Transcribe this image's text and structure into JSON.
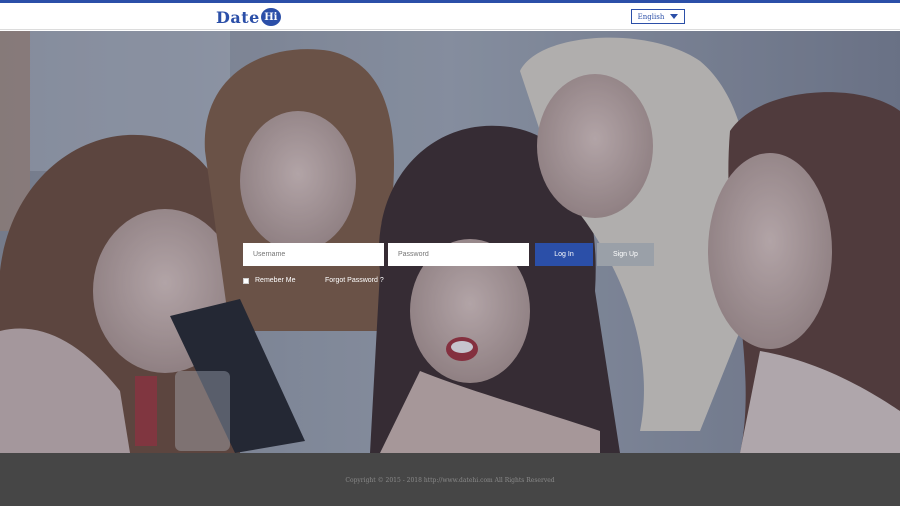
{
  "header": {
    "logo_text": "Date",
    "logo_badge": "Hi",
    "language": {
      "selected": "English"
    }
  },
  "login": {
    "username_placeholder": "Username",
    "password_placeholder": "Password",
    "login_label": "Log In",
    "signup_label": "Sign Up",
    "remember_label": "Remeber Me",
    "forgot_label": "Forgot Password ?"
  },
  "footer": {
    "copyright": "Copyright © 2015 - 2018 http://www.datehi.com All Rights Reserved"
  },
  "colors": {
    "brand": "#2b4fa8",
    "footer_bg": "#464646",
    "signup_bg": "#9aa0a8"
  },
  "icons": {
    "language_dropdown": "caret-down-icon",
    "remember_checkbox": "checkbox-icon"
  }
}
